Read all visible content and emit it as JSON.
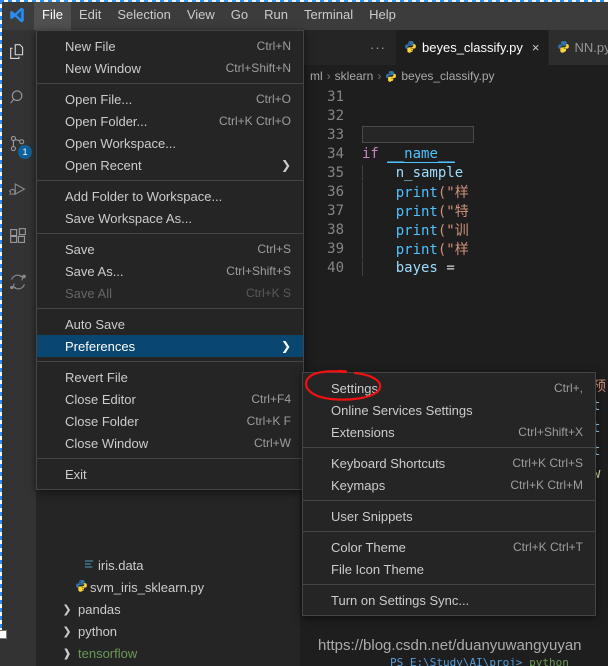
{
  "window": {
    "app": "Visual Studio Code",
    "logo_name": "vscode-logo"
  },
  "menubar": {
    "items": [
      {
        "label": "File",
        "active": true
      },
      {
        "label": "Edit",
        "active": false
      },
      {
        "label": "Selection",
        "active": false
      },
      {
        "label": "View",
        "active": false
      },
      {
        "label": "Go",
        "active": false
      },
      {
        "label": "Run",
        "active": false
      },
      {
        "label": "Terminal",
        "active": false
      },
      {
        "label": "Help",
        "active": false
      }
    ]
  },
  "activitybar": {
    "items": [
      {
        "name": "explorer-icon",
        "badge": ""
      },
      {
        "name": "search-icon",
        "badge": ""
      },
      {
        "name": "source-control-icon",
        "badge": "1"
      },
      {
        "name": "run-and-debug-icon",
        "badge": ""
      },
      {
        "name": "extensions-icon",
        "badge": ""
      },
      {
        "name": "sync-diff-icon",
        "badge": ""
      }
    ]
  },
  "file_menu": {
    "items": [
      {
        "label": "New File",
        "key": "Ctrl+N",
        "type": "item"
      },
      {
        "label": "New Window",
        "key": "Ctrl+Shift+N",
        "type": "item"
      },
      {
        "type": "separator"
      },
      {
        "label": "Open File...",
        "key": "Ctrl+O",
        "type": "item"
      },
      {
        "label": "Open Folder...",
        "key": "Ctrl+K Ctrl+O",
        "type": "item"
      },
      {
        "label": "Open Workspace...",
        "key": "",
        "type": "item"
      },
      {
        "label": "Open Recent",
        "key": "",
        "type": "submenu"
      },
      {
        "type": "separator"
      },
      {
        "label": "Add Folder to Workspace...",
        "key": "",
        "type": "item"
      },
      {
        "label": "Save Workspace As...",
        "key": "",
        "type": "item"
      },
      {
        "type": "separator"
      },
      {
        "label": "Save",
        "key": "Ctrl+S",
        "type": "item"
      },
      {
        "label": "Save As...",
        "key": "Ctrl+Shift+S",
        "type": "item"
      },
      {
        "label": "Save All",
        "key": "Ctrl+K S",
        "type": "disabled"
      },
      {
        "type": "separator"
      },
      {
        "label": "Auto Save",
        "key": "",
        "type": "item"
      },
      {
        "label": "Preferences",
        "key": "",
        "type": "submenu-selected"
      },
      {
        "type": "separator"
      },
      {
        "label": "Revert File",
        "key": "",
        "type": "item"
      },
      {
        "label": "Close Editor",
        "key": "Ctrl+F4",
        "type": "item"
      },
      {
        "label": "Close Folder",
        "key": "Ctrl+K F",
        "type": "item"
      },
      {
        "label": "Close Window",
        "key": "Ctrl+W",
        "type": "item"
      },
      {
        "type": "separator"
      },
      {
        "label": "Exit",
        "key": "",
        "type": "item"
      }
    ]
  },
  "preferences_menu": {
    "items": [
      {
        "label": "Settings",
        "key": "Ctrl+,",
        "type": "item"
      },
      {
        "label": "Online Services Settings",
        "key": "",
        "type": "item"
      },
      {
        "label": "Extensions",
        "key": "Ctrl+Shift+X",
        "type": "item"
      },
      {
        "type": "separator"
      },
      {
        "label": "Keyboard Shortcuts",
        "key": "Ctrl+K Ctrl+S",
        "type": "item"
      },
      {
        "label": "Keymaps",
        "key": "Ctrl+K Ctrl+M",
        "type": "item"
      },
      {
        "type": "separator"
      },
      {
        "label": "User Snippets",
        "key": "",
        "type": "item"
      },
      {
        "type": "separator"
      },
      {
        "label": "Color Theme",
        "key": "Ctrl+K Ctrl+T",
        "type": "item"
      },
      {
        "label": "File Icon Theme",
        "key": "",
        "type": "item"
      },
      {
        "type": "separator"
      },
      {
        "label": "Turn on Settings Sync...",
        "key": "",
        "type": "item"
      }
    ]
  },
  "annotation": {
    "target_label": "Settings",
    "color": "#ee1111",
    "shape": "hand-drawn-ellipse"
  },
  "explorer": {
    "tree": [
      {
        "label": "iris.data",
        "icon": "data-file-icon",
        "indent": 1,
        "twisty": "",
        "color": "normal"
      },
      {
        "label": "svm_iris_sklearn.py",
        "icon": "python-file-icon",
        "indent": 1,
        "twisty": "",
        "color": "normal"
      },
      {
        "label": "pandas",
        "icon": "",
        "indent": 0,
        "twisty": "collapsed",
        "color": "normal"
      },
      {
        "label": "python",
        "icon": "",
        "indent": 0,
        "twisty": "collapsed",
        "color": "normal"
      },
      {
        "label": "tensorflow",
        "icon": "",
        "indent": 0,
        "twisty": "expanded",
        "color": "green"
      }
    ]
  },
  "editor": {
    "more_actions": "···",
    "tabs": [
      {
        "label": "beyes_classify.py",
        "icon": "python-file-icon",
        "active": true,
        "close": "×"
      },
      {
        "label": "NN.py",
        "icon": "python-file-icon",
        "active": false,
        "close": ""
      }
    ],
    "breadcrumbs": [
      "ml",
      "sklearn",
      "beyes_classify.py"
    ],
    "breadcrumb_separator": "›",
    "lines": [
      {
        "num": "31",
        "kind": "blank"
      },
      {
        "num": "32",
        "kind": "blank"
      },
      {
        "num": "33",
        "kind": "findbox"
      },
      {
        "num": "34",
        "kind": "if_main"
      },
      {
        "num": "35",
        "kind": "n_samples"
      },
      {
        "num": "36",
        "kind": "print1"
      },
      {
        "num": "37",
        "kind": "print2"
      },
      {
        "num": "38",
        "kind": "print3"
      },
      {
        "num": "39",
        "kind": "print4"
      },
      {
        "num": "40",
        "kind": "bayes"
      }
    ],
    "tokens": {
      "if": "if",
      "dunder_name": "__name__",
      "n_sample": "n_sample",
      "print": "print",
      "paren_quote": "(\"",
      "cn36": "样",
      "cn37": "特",
      "cn38": "训",
      "cn39": "样",
      "bayes": "bayes",
      "equals": "= "
    },
    "right_clipped": [
      "预",
      "t",
      "t",
      "t",
      "w"
    ]
  },
  "watermark": {
    "url": "https://blog.csdn.net/duanyuwangyuyan"
  },
  "terminal": {
    "prompt": "PS E:\\Study\\AI\\proj>",
    "command": "python"
  },
  "colors": {
    "accent": "#0e639c",
    "selection": "#094771",
    "annotation_red": "#ee1111",
    "tree_green": "#6a9955",
    "titlebar_bg": "#3c3c3c",
    "activitybar_bg": "#333333",
    "sidebar_bg": "#252526",
    "editor_bg": "#1e1e1e"
  }
}
